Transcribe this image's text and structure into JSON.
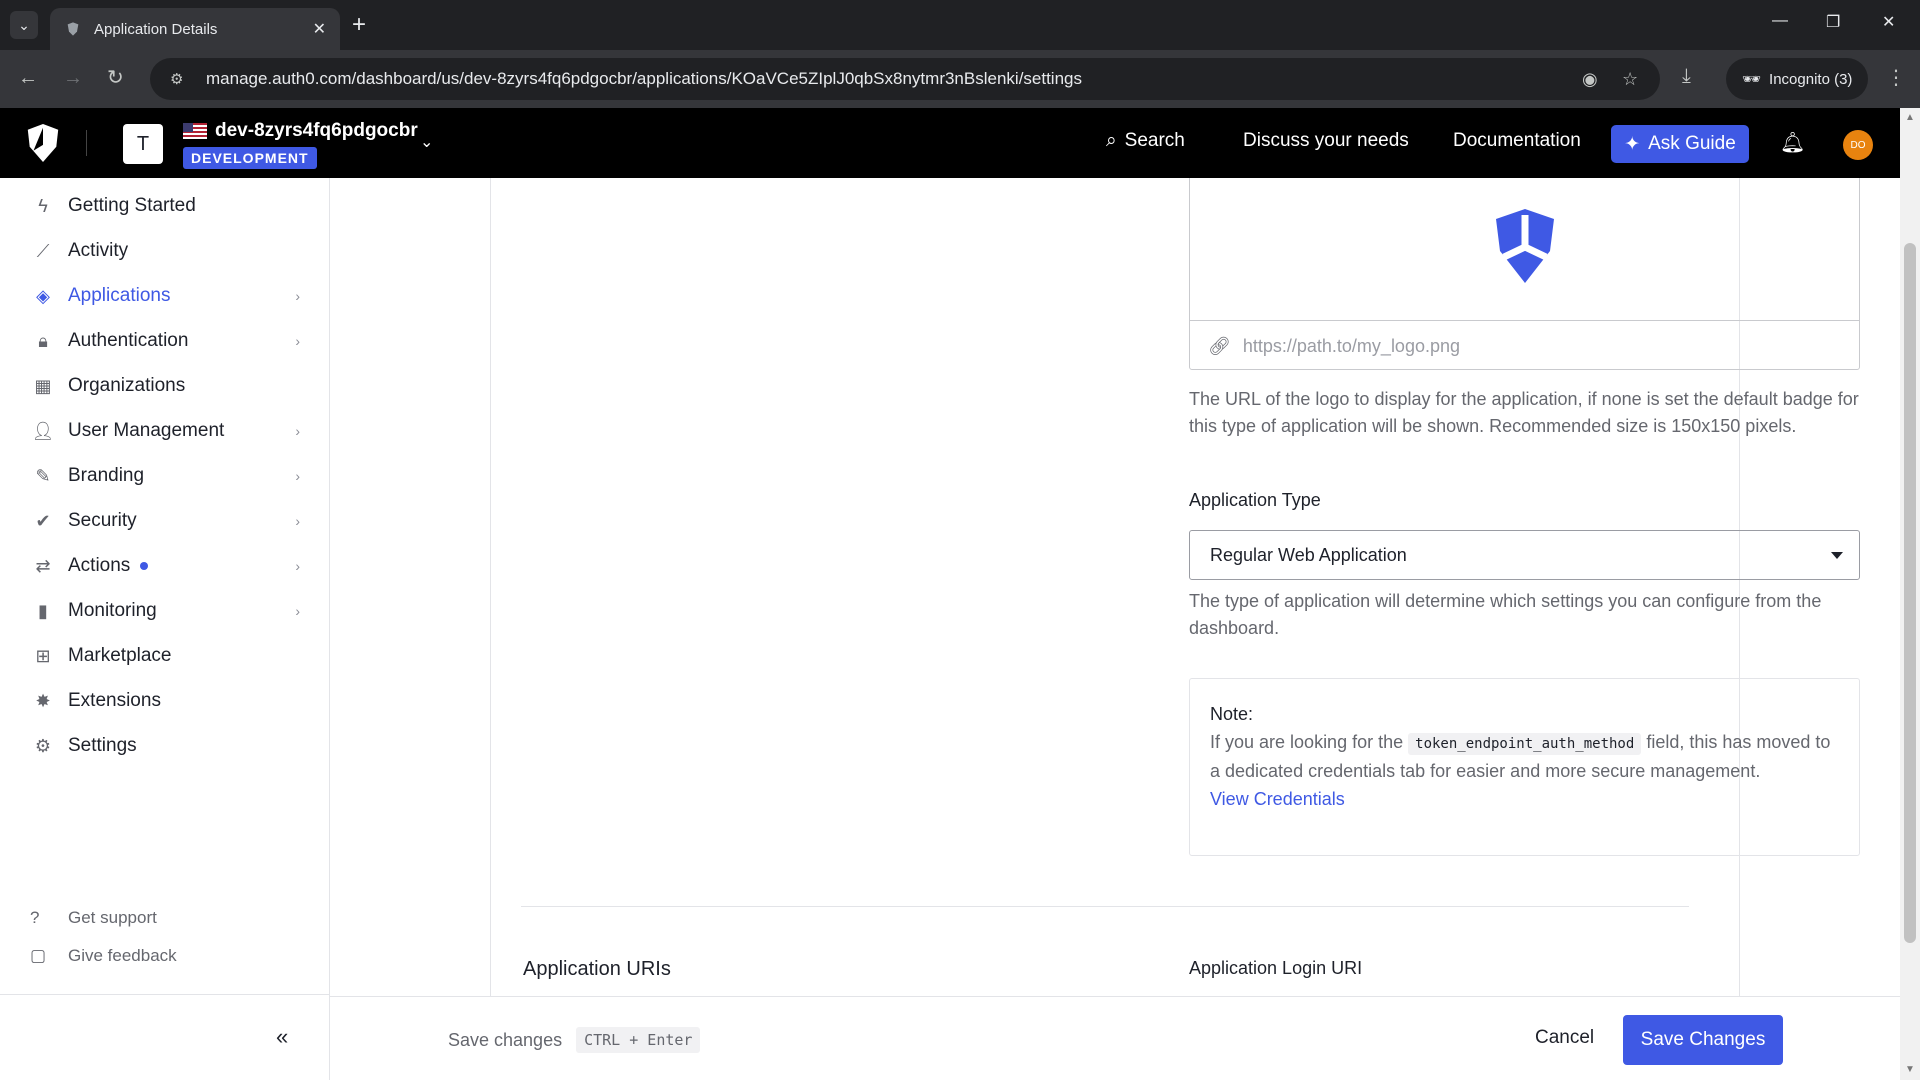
{
  "browser": {
    "tab_title": "Application Details",
    "url": "manage.auth0.com/dashboard/us/dev-8zyrs4fq6pdgocbr/applications/KOaVCe5ZIplJ0qbSx8nytmr3nBslenki/settings",
    "incognito_label": "Incognito (3)"
  },
  "header": {
    "tenant_initial": "T",
    "tenant_name": "dev-8zyrs4fq6pdgocbr",
    "environment": "DEVELOPMENT",
    "search_label": "Search",
    "discuss_label": "Discuss your needs",
    "docs_label": "Documentation",
    "ask_guide_label": "Ask Guide",
    "user_initials": "DO"
  },
  "sidebar": {
    "items": [
      {
        "label": "Getting Started",
        "icon": "bolt-icon"
      },
      {
        "label": "Activity",
        "icon": "chart-line-icon"
      },
      {
        "label": "Applications",
        "icon": "layers-icon"
      },
      {
        "label": "Authentication",
        "icon": "lock-icon"
      },
      {
        "label": "Organizations",
        "icon": "building-icon"
      },
      {
        "label": "User Management",
        "icon": "users-icon"
      },
      {
        "label": "Branding",
        "icon": "pen-icon"
      },
      {
        "label": "Security",
        "icon": "shield-check-icon"
      },
      {
        "label": "Actions",
        "icon": "actions-icon"
      },
      {
        "label": "Monitoring",
        "icon": "bar-chart-icon"
      },
      {
        "label": "Marketplace",
        "icon": "grid-plus-icon"
      },
      {
        "label": "Extensions",
        "icon": "puzzle-icon"
      },
      {
        "label": "Settings",
        "icon": "gear-icon"
      }
    ],
    "get_support": "Get support",
    "give_feedback": "Give feedback"
  },
  "main": {
    "logo_url_placeholder": "https://path.to/my_logo.png",
    "logo_help": "The URL of the logo to display for the application, if none is set the default badge for this type of application will be shown. Recommended size is 150x150 pixels.",
    "app_type_label": "Application Type",
    "app_type_value": "Regular Web Application",
    "app_type_help": "The type of application will determine which settings you can configure from the dashboard.",
    "note": {
      "title": "Note:",
      "text_before": "If you are looking for the",
      "code": "token_endpoint_auth_method",
      "text_after": "field, this has moved to a dedicated credentials tab for easier and more secure management.",
      "link": "View Credentials"
    },
    "section_title": "Application URIs",
    "login_uri_label": "Application Login URI"
  },
  "footer": {
    "hint": "Save changes",
    "shortcut": "CTRL + Enter",
    "cancel": "Cancel",
    "save": "Save Changes"
  },
  "colors": {
    "accent": "#3f59e4",
    "header_bg": "#000000",
    "avatar": "#e8830f"
  }
}
